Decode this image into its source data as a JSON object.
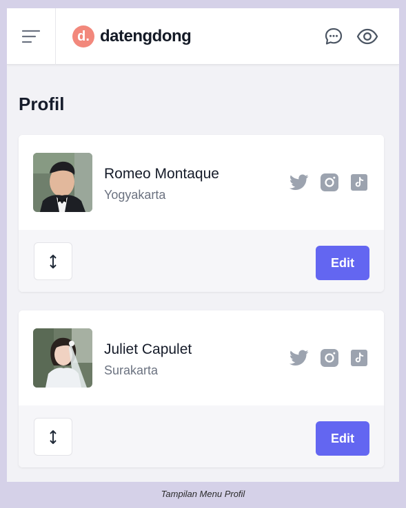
{
  "header": {
    "logo_mark": "d.",
    "logo_text": "datengdong",
    "logo_color": "#f2887c",
    "icons": [
      "hamburger-menu-icon",
      "chat-bubble-icon",
      "eye-icon"
    ]
  },
  "page": {
    "title": "Profil"
  },
  "profiles": [
    {
      "name": "Romeo Montaque",
      "city": "Yogyakarta",
      "social_icons": [
        "twitter-icon",
        "instagram-icon",
        "tiktok-icon"
      ],
      "sort_icon": "up-down-arrow-icon",
      "edit_label": "Edit"
    },
    {
      "name": "Juliet Capulet",
      "city": "Surakarta",
      "social_icons": [
        "twitter-icon",
        "instagram-icon",
        "tiktok-icon"
      ],
      "sort_icon": "up-down-arrow-icon",
      "edit_label": "Edit"
    }
  ],
  "colors": {
    "accent": "#6366f1",
    "background": "#f2f2f6",
    "icon_gray": "#9ca3af"
  },
  "caption": "Tampilan Menu Profil"
}
